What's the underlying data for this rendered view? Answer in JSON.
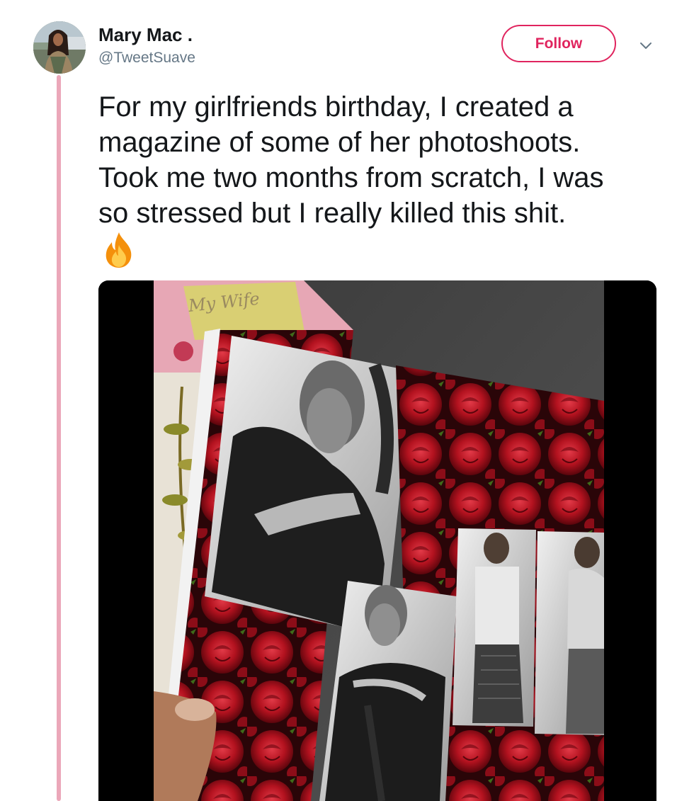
{
  "tweet": {
    "author": {
      "display_name": "Mary Mac .",
      "handle": "@TweetSuave"
    },
    "follow_label": "Follow",
    "text_lines": [
      "For my girlfriends birthday, I created a",
      "magazine of some of her photoshoots.",
      "Took me two months from scratch, I was",
      "so stressed but I really killed this shit."
    ],
    "emoji": "fire-icon",
    "media": {
      "cover_handwriting": "My Wife"
    }
  },
  "colors": {
    "accent": "#e0245e",
    "thread_line": "#eba7b9",
    "text": "#14171a",
    "secondary_text": "#657786"
  },
  "icons": {
    "menu": "chevron-down-icon"
  }
}
